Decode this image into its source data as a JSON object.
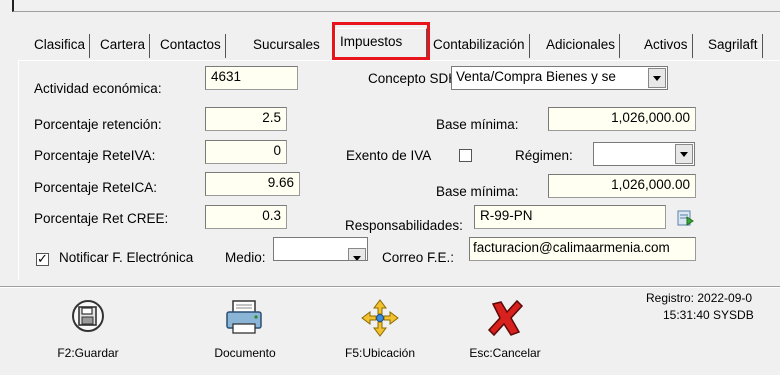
{
  "tabs": [
    {
      "label": "Clasifica"
    },
    {
      "label": "Cartera"
    },
    {
      "label": "Contactos"
    },
    {
      "label": "Sucursales"
    },
    {
      "label": "Impuestos",
      "active": true
    },
    {
      "label": "Contabilización"
    },
    {
      "label": "Adicionales"
    },
    {
      "label": "Activos"
    },
    {
      "label": "Sagrilaft"
    }
  ],
  "form": {
    "actividad_label": "Actividad económica:",
    "actividad_value": "4631",
    "concepto_label": "Concepto SDH:",
    "concepto_value": "Venta/Compra Bienes y se",
    "retencion_label": "Porcentaje retención:",
    "retencion_value": "2.5",
    "base_min_label": "Base mínima:",
    "base_min_value": "1,026,000.00",
    "reteiva_label": "Porcentaje ReteIVA:",
    "reteiva_value": "0",
    "exento_iva_label": "Exento de IVA",
    "exento_iva_checked": false,
    "regimen_label": "Régimen:",
    "regimen_value": "",
    "reteica_label": "Porcentaje ReteICA:",
    "reteica_value": "9.66",
    "base_min2_label": "Base mínima:",
    "base_min2_value": "1,026,000.00",
    "cree_label": "Porcentaje Ret CREE:",
    "cree_value": "0.3",
    "responsabilidades_label": "Responsabilidades:",
    "responsabilidades_value": "R-99-PN",
    "notificar_label": "Notificar F. Electrónica",
    "notificar_checked": true,
    "medio_label": "Medio:",
    "medio_value": "",
    "correo_label": "Correo F.E.:",
    "correo_value": "facturacion@calimaarmenia.com"
  },
  "toolbar": {
    "guardar_label": "F2:Guardar",
    "documento_label": "Documento",
    "ubicacion_label": "F5:Ubicación",
    "cancelar_label": "Esc:Cancelar"
  },
  "registro": {
    "line1": "Registro: 2022-09-0",
    "line2": "15:31:40 SYSDB"
  },
  "colors": {
    "highlight": "#e8141c",
    "field_bg": "#fffff2",
    "window_bg": "#f0f0f0"
  }
}
